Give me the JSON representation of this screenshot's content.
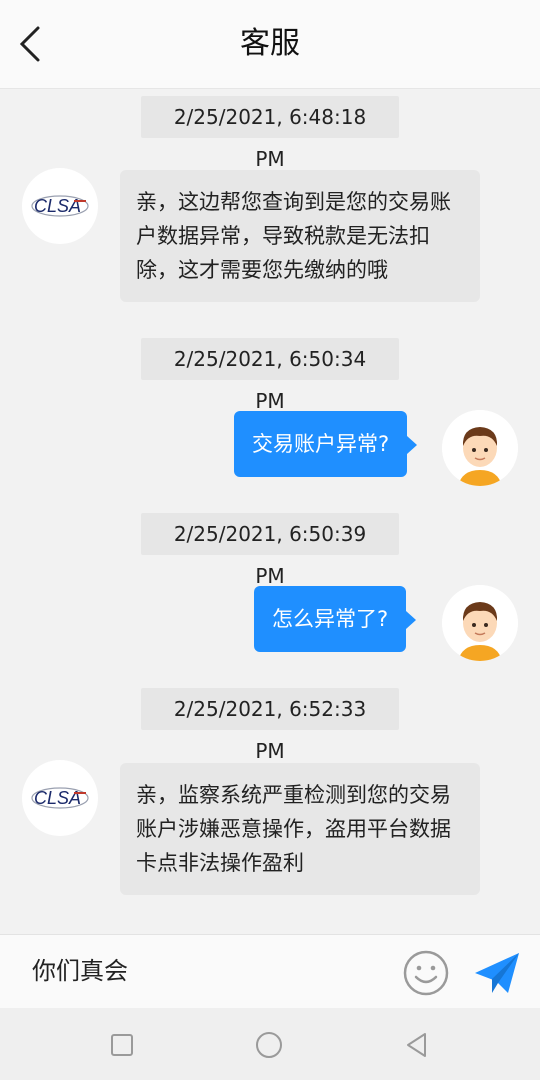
{
  "header": {
    "title": "客服"
  },
  "messages": [
    {
      "timestamp": "2/25/2021, 6:48:18 PM",
      "text": "亲，这边帮您查询到是您的交易账户数据异常，导致税款是无法扣除，这才需要您先缴纳的哦"
    },
    {
      "timestamp": "2/25/2021, 6:50:34 PM",
      "text": "交易账户异常?"
    },
    {
      "timestamp": "2/25/2021, 6:50:39 PM",
      "text": "怎么异常了?"
    },
    {
      "timestamp": "2/25/2021, 6:52:33 PM",
      "text": "亲，监察系统严重检测到您的交易账户涉嫌恶意操作，盗用平台数据卡点非法操作盈利"
    }
  ],
  "agent_logo_text": "CLSA",
  "input": {
    "value": "你们真会"
  },
  "colors": {
    "accent": "#1f8fff",
    "agent_bubble": "#e7e7e7",
    "background": "#f2f2f2"
  }
}
